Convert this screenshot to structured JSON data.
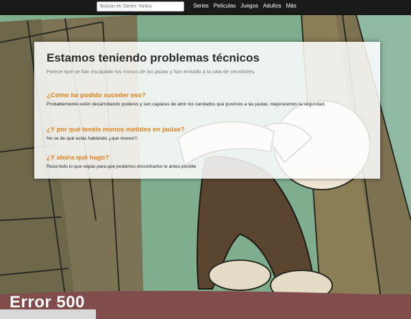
{
  "search": {
    "placeholder": "Buscar en Series Yonkis"
  },
  "nav": {
    "items": [
      "Series",
      "Películas",
      "Juegos",
      "Adultos",
      "Más"
    ]
  },
  "panel": {
    "title": "Estamos teniendo problemas técnicos",
    "subtitle": "Parece que se han escapado los monos de las jaulas y han entrado a la sala de servidores.",
    "questions": [
      {
        "q": "¿Cómo ha podido suceder eso?",
        "a": "Probablemente estén desarrollando poderes y son capaces de abrir los candados que pusimos a las jaulas, mejoraremos la seguridad."
      },
      {
        "q": "¿Y por qué tenéis monos metidos en jaulas?",
        "a": "No se de qué estás hablando ¿que monos?."
      },
      {
        "q": "¿Y ahora qué hago?",
        "a": "Reza todo lo que sepas para que podamos encontrarlos lo antes posible"
      }
    ]
  },
  "error_label": "Error 500",
  "colors": {
    "accent": "#e8821c",
    "topbar": "#1a1a1a"
  }
}
